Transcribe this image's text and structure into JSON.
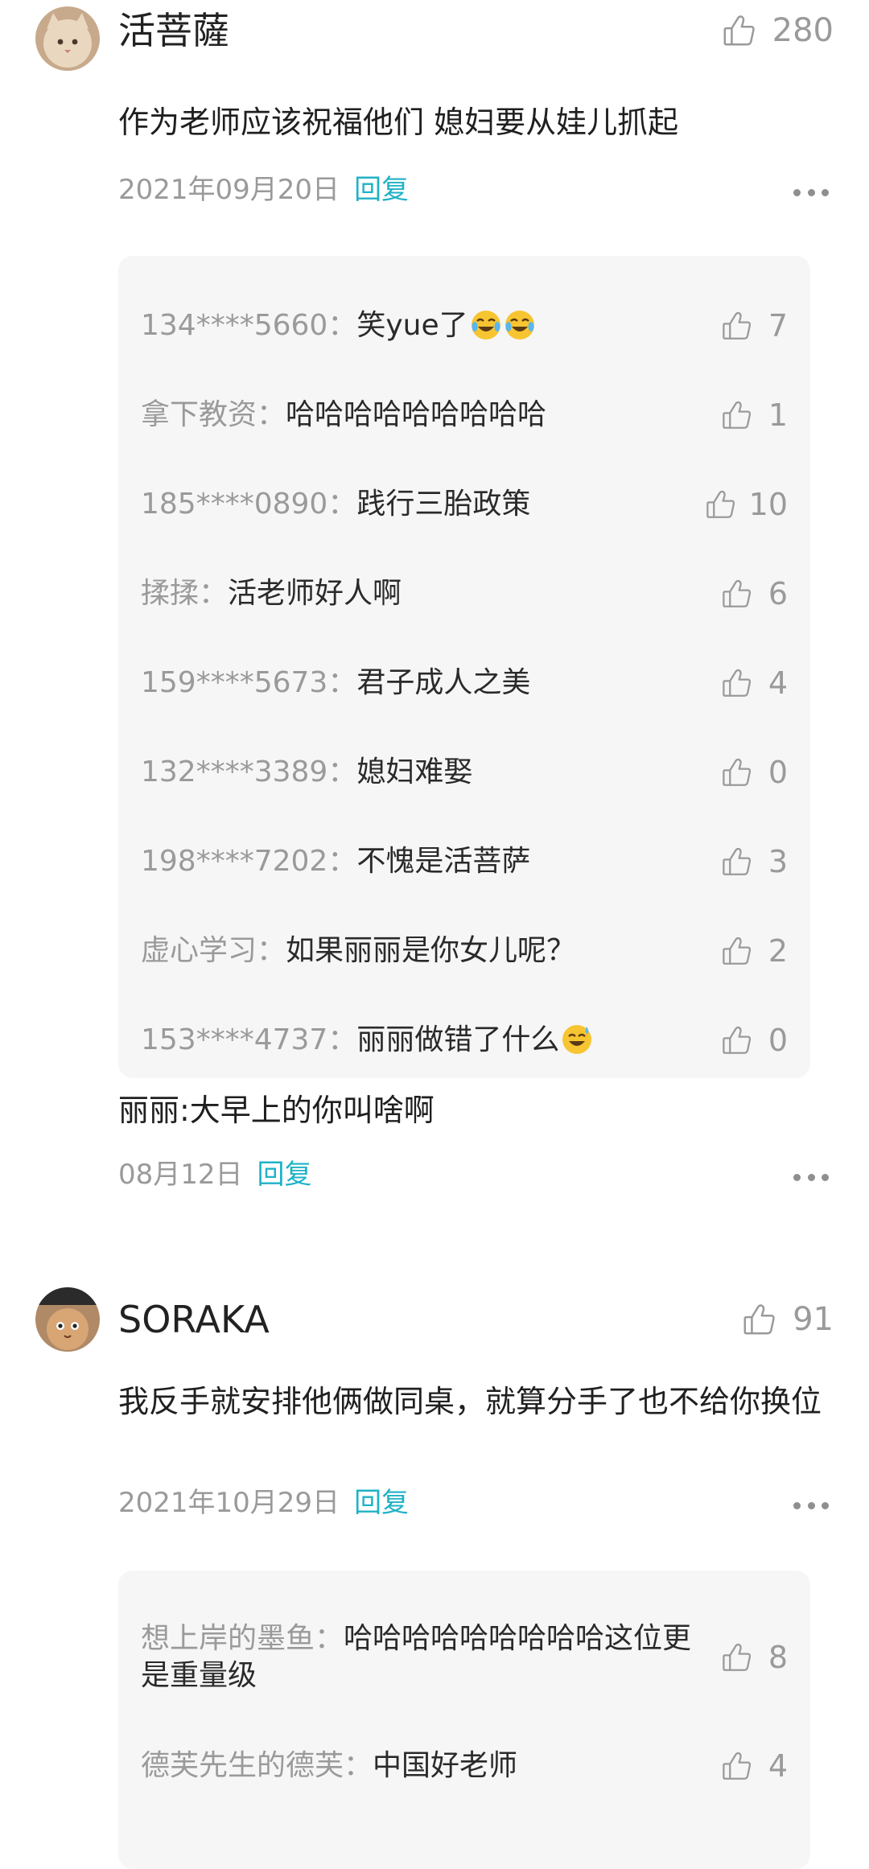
{
  "comments": [
    {
      "username": "活菩薩",
      "likes": "280",
      "text": "作为老师应该祝福他们  媳妇要从娃儿抓起",
      "date": "2021年09月20日",
      "reply_label": "回复",
      "replies": [
        {
          "name": "134****5660：",
          "text": "笑yue了",
          "emoji": [
            "laugh-cry-emoji",
            "laugh-cry-emoji"
          ],
          "likes": "7"
        },
        {
          "name": "拿下教资：",
          "text": "哈哈哈哈哈哈哈哈哈",
          "likes": "1"
        },
        {
          "name": "185****0890：",
          "text": "践行三胎政策",
          "likes": "10"
        },
        {
          "name": "揉揉：",
          "text": "活老师好人啊",
          "likes": "6"
        },
        {
          "name": "159****5673：",
          "text": "君子成人之美",
          "likes": "4"
        },
        {
          "name": "132****3389：",
          "text": "媳妇难娶",
          "likes": "0"
        },
        {
          "name": "198****7202：",
          "text": "不愧是活菩萨",
          "likes": "3"
        },
        {
          "name": "虚心学习：",
          "text": "如果丽丽是你女儿呢？",
          "likes": "2"
        },
        {
          "name": "153****4737：",
          "text": "丽丽做错了什么",
          "emoji": [
            "sweat-smile-emoji"
          ],
          "likes": "0"
        }
      ],
      "followup_text": "丽丽:大早上的你叫啥啊",
      "followup_date": "08月12日",
      "followup_reply_label": "回复"
    },
    {
      "username": "SORAKA",
      "likes": "91",
      "text": "我反手就安排他俩做同桌，就算分手了也不给你换位",
      "date": "2021年10月29日",
      "reply_label": "回复",
      "replies": [
        {
          "name": "想上岸的墨鱼：",
          "text": "哈哈哈哈哈哈哈哈哈这位更是重量级",
          "likes": "8"
        },
        {
          "name": "德芙先生的德芙：",
          "text": "中国好老师",
          "likes": "4"
        }
      ]
    }
  ],
  "colors": {
    "reply_link": "#1fb2c6",
    "muted": "#9a9a9a",
    "reply_box_bg": "#f6f6f6"
  }
}
